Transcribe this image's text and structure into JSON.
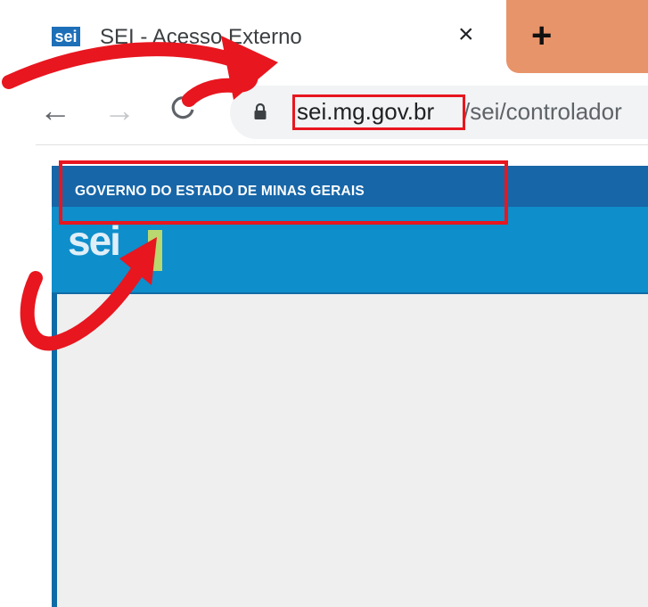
{
  "browser": {
    "tab": {
      "favicon_text": "sei",
      "title": "SEI - Acesso Externo",
      "close_symbol": "×"
    },
    "new_tab_symbol": "+",
    "nav": {
      "back_symbol": "←",
      "forward_symbol": "→"
    },
    "address_bar": {
      "host": "sei.mg.gov.br",
      "path": "/sei/controlador"
    }
  },
  "page": {
    "header_title": "GOVERNO DO ESTADO DE MINAS GERAIS",
    "logo_text": "sei"
  },
  "annotations": {
    "highlight_color": "#e8161f",
    "arrow_color": "#e8161f"
  },
  "colors": {
    "newtab_bg": "#e8946a",
    "gov_bar": "#1766a8",
    "sei_band": "#0e8ecb",
    "logo_accent": "#b9d870"
  }
}
